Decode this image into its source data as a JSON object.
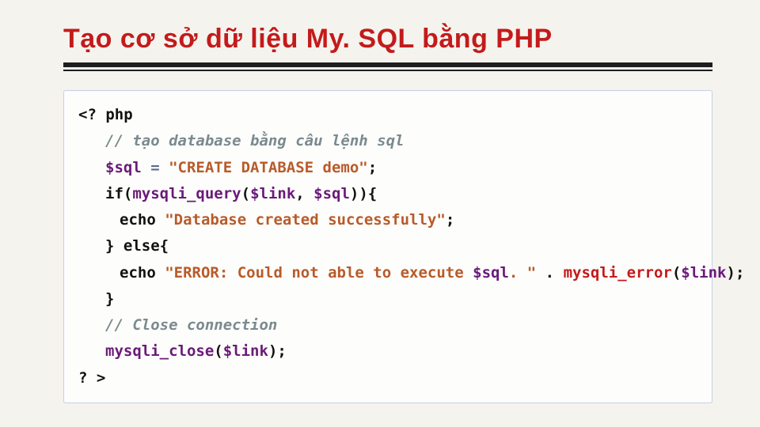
{
  "title": "Tạo cơ sở dữ liệu My. SQL bằng PHP",
  "code": {
    "open": "<? php",
    "comment1": "// tạo database bằng câu lệnh sql",
    "var_sql": "$sql",
    "eq": " = ",
    "str_create": "\"CREATE DATABASE demo\"",
    "semi": ";",
    "if_open_a": "if(",
    "fn_query": "mysqli_query",
    "if_open_b": "(",
    "var_link": "$link",
    "comma": ", ",
    "if_open_c": ")){",
    "echo": "echo ",
    "str_success": "\"Database created successfully\"",
    "else": "} else{",
    "str_error": "\"ERROR: Could not able to execute ",
    "dot_sp": ". \"",
    "dot": " . ",
    "fn_err": "mysqli_error",
    "close_brace": "}",
    "comment2": "// Close connection",
    "fn_close": "mysqli_close",
    "paren_close_semi": ");",
    "close": "? >"
  }
}
